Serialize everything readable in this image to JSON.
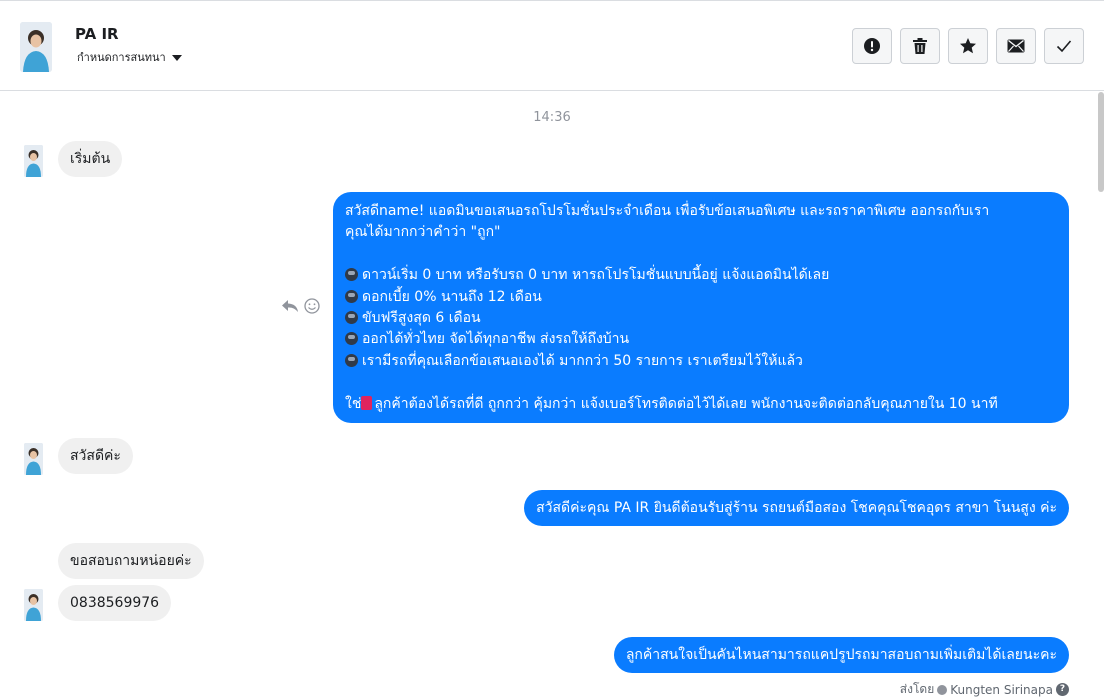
{
  "header": {
    "contact_name": "PA IR",
    "assign_label": "กำหนดการสนทนา",
    "actions": [
      {
        "name": "report",
        "icon": "exclamation-circle-icon"
      },
      {
        "name": "delete",
        "icon": "trash-icon"
      },
      {
        "name": "star",
        "icon": "star-icon"
      },
      {
        "name": "mark-unread",
        "icon": "envelope-icon"
      },
      {
        "name": "mark-done",
        "icon": "checkmark-icon"
      }
    ]
  },
  "chat": {
    "timestamp": "14:36",
    "messages": [
      {
        "from": "customer",
        "text": "เริ่มต้น"
      },
      {
        "from": "page",
        "lines": [
          "สวัสดีname! แอดมินขอเสนอรถโปรโมชั่นประจำเดือน เพื่อรับข้อเสนอพิเศษ และรถราคาพิเศษ ออกรถกับเรา",
          "คุณได้มากกว่าคำว่า \"ถูก\"",
          "",
          "ดาวน์เริ่ม 0 บาท หรือรับรถ 0 บาท หารถโปรโมชั่นแบบนี้อยู่ แจ้งแอดมินได้เลย",
          "ดอกเบี้ย 0% นานถึง 12 เดือน",
          "ขับฟรีสูงสุด 6 เดือน",
          "ออกได้ทั่วไทย จัดได้ทุกอาชีพ ส่งรถให้ถึงบ้าน",
          "เรามีรถที่คุณเลือกข้อเสนอเองได้ มากกว่า 50 รายการ เราเตรียมไว้ให้แล้ว",
          "",
          "ใช่",
          "ลูกค้าต้องได้รถที่ดี ถูกกว่า คุ้มกว่า แจ้งเบอร์โทรติดต่อไว้ได้เลย พนักงานจะติดต่อกลับคุณภายใน 10 นาที"
        ]
      },
      {
        "from": "customer",
        "text": "สวัสดีค่ะ"
      },
      {
        "from": "page",
        "text": "สวัสดีค่ะคุณ PA IR ยินดีต้อนรับสู่ร้าน รถยนต์มือสอง โชคคุณโชคอุดร สาขา โนนสูง ค่ะ"
      },
      {
        "from": "customer",
        "text": "ขอสอบถามหน่อยค่ะ"
      },
      {
        "from": "customer",
        "text": "0838569976"
      },
      {
        "from": "page",
        "text": "ลูกค้าสนใจเป็นคันไหนสามารถแคปรูปรถมาสอบถามเพิ่มเติมได้เลยนะคะ"
      }
    ],
    "sent_by_label": "ส่งโดย",
    "sent_by_name": "Kungten Sirinapa",
    "help_glyph": "?"
  },
  "colors": {
    "outgoing_bubble": "#0a7cff",
    "incoming_bubble": "#f0f0f0"
  }
}
